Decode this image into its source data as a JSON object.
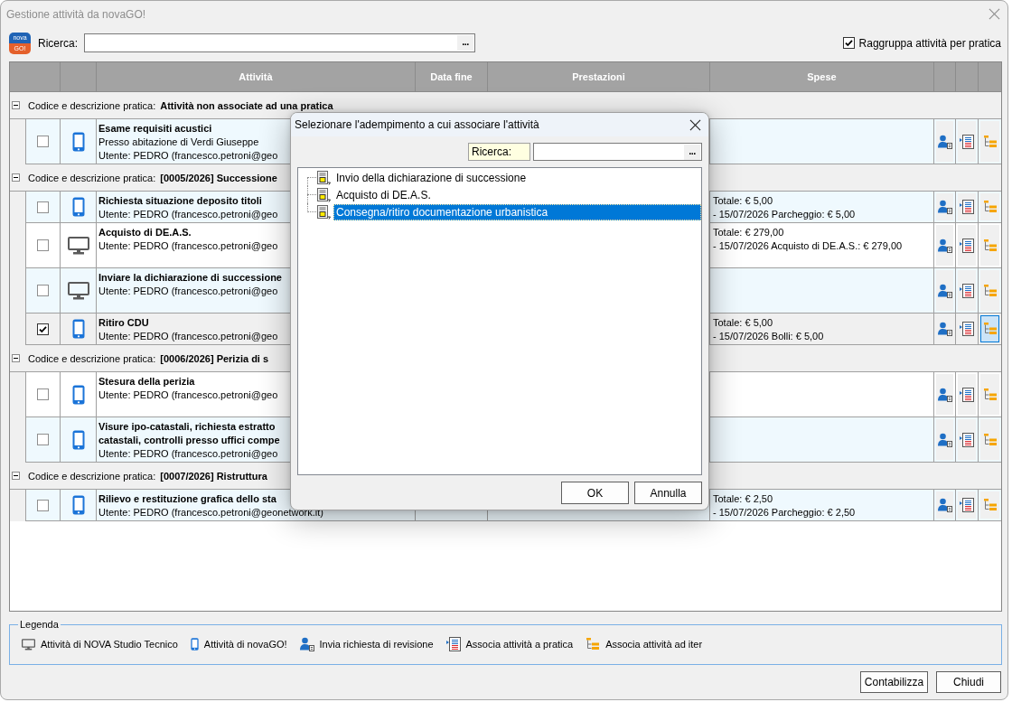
{
  "window": {
    "title": "Gestione attività da novaGO!"
  },
  "logo": {
    "top": "nova",
    "bottom": "GO!"
  },
  "search": {
    "label": "Ricerca:",
    "button": "..."
  },
  "group_by": {
    "label": "Raggruppa attività per pratica",
    "checked": true
  },
  "table": {
    "columns": [
      "Attività",
      "Data fine",
      "Prestazioni",
      "Spese"
    ],
    "groups": [
      {
        "label": "Codice e descrizione pratica:",
        "name": "Attività non associate ad una pratica",
        "expanded": true,
        "rows": [
          {
            "checked": false,
            "selected": false,
            "highlighted": true,
            "tall": false,
            "kind": "phone",
            "title": "Esame requisiti acustici",
            "details": [
              "Presso abitazione di Verdi Giuseppe",
              "Utente: PEDRO (francesco.petroni@geo"
            ],
            "actions": [
              {
                "kind": "revision",
                "selected": false
              },
              {
                "kind": "practice",
                "selected": false
              },
              {
                "kind": "iter",
                "selected": false
              }
            ]
          }
        ]
      },
      {
        "label": "Codice e descrizione pratica:",
        "name": "[0005/2026] Successione",
        "expanded": true,
        "rows": [
          {
            "checked": false,
            "selected": false,
            "highlighted": true,
            "tall": false,
            "kind": "phone",
            "title": "Richiesta situazione deposito titoli",
            "details": [
              "Utente: PEDRO (francesco.petroni@geo"
            ],
            "expenses": [
              "Totale: € 5,00",
              "- 15/07/2026 Parcheggio: € 5,00"
            ],
            "actions": [
              {
                "kind": "revision",
                "selected": false
              },
              {
                "kind": "practice",
                "selected": false
              },
              {
                "kind": "iter",
                "selected": false
              }
            ]
          },
          {
            "checked": false,
            "selected": false,
            "highlighted": false,
            "tall": true,
            "kind": "desktop",
            "title": "Acquisto di DE.A.S.",
            "details": [
              "Utente: PEDRO (francesco.petroni@geo"
            ],
            "expenses": [
              "Totale: € 279,00",
              "- 15/07/2026 Acquisto di DE.A.S.: € 279,00"
            ],
            "actions": [
              {
                "kind": "revision",
                "selected": false
              },
              {
                "kind": "practice",
                "selected": false
              },
              {
                "kind": "iter",
                "selected": false
              }
            ]
          },
          {
            "checked": false,
            "selected": false,
            "highlighted": true,
            "tall": true,
            "kind": "desktop",
            "title": "Inviare la dichiarazione di successione",
            "details": [
              "Utente: PEDRO (francesco.petroni@geo"
            ],
            "actions": [
              {
                "kind": "revision",
                "selected": false
              },
              {
                "kind": "practice",
                "selected": false
              },
              {
                "kind": "iter",
                "selected": false
              }
            ]
          },
          {
            "checked": true,
            "selected": true,
            "highlighted": false,
            "tall": false,
            "kind": "phone",
            "title": "Ritiro CDU",
            "details": [
              "Utente: PEDRO (francesco.petroni@geo"
            ],
            "expenses": [
              "Totale: € 5,00",
              "- 15/07/2026 Bolli: € 5,00"
            ],
            "actions": [
              {
                "kind": "revision",
                "selected": false
              },
              {
                "kind": "practice",
                "selected": false
              },
              {
                "kind": "iter",
                "selected": true
              }
            ]
          }
        ]
      },
      {
        "label": "Codice e descrizione pratica:",
        "name": "[0006/2026] Perizia di s",
        "expanded": true,
        "rows": [
          {
            "checked": false,
            "selected": false,
            "highlighted": false,
            "tall": true,
            "kind": "phone",
            "title": "Stesura della perizia",
            "details": [
              "Utente: PEDRO (francesco.petroni@geo"
            ],
            "actions": [
              {
                "kind": "revision",
                "selected": false
              },
              {
                "kind": "practice",
                "selected": false
              },
              {
                "kind": "iter",
                "selected": false
              }
            ]
          },
          {
            "checked": false,
            "selected": false,
            "highlighted": true,
            "tall": false,
            "kind": "phone",
            "title": "Visure ipo-catastali, richiesta estratto\ncatastali, controlli presso uffici compe",
            "details": [
              "Utente: PEDRO (francesco.petroni@geo"
            ],
            "actions": [
              {
                "kind": "revision",
                "selected": false
              },
              {
                "kind": "practice",
                "selected": false
              },
              {
                "kind": "iter",
                "selected": false
              }
            ]
          }
        ]
      },
      {
        "label": "Codice e descrizione pratica:",
        "name": "[0007/2026] Ristruttura",
        "expanded": true,
        "rows": [
          {
            "checked": false,
            "selected": false,
            "highlighted": true,
            "tall": false,
            "kind": "phone",
            "title": "Rilievo e restituzione grafica dello sta",
            "details": [
              "Utente: PEDRO (francesco.petroni@geonetwork.it)"
            ],
            "expenses": [
              "Totale: € 2,50",
              "- 15/07/2026 Parcheggio: € 2,50"
            ],
            "actions": [
              {
                "kind": "revision",
                "selected": false
              },
              {
                "kind": "practice",
                "selected": false
              },
              {
                "kind": "iter",
                "selected": false
              }
            ]
          }
        ]
      }
    ]
  },
  "legend": {
    "title": "Legenda",
    "items": [
      {
        "kind": "desktop",
        "label": "Attività di NOVA Studio Tecnico"
      },
      {
        "kind": "phone",
        "label": "Attività di novaGO!"
      },
      {
        "kind": "revision",
        "label": "Invia richiesta di revisione"
      },
      {
        "kind": "practice",
        "label": "Associa attività a pratica"
      },
      {
        "kind": "iter",
        "label": "Associa attività ad iter"
      }
    ]
  },
  "buttons": [
    "Contabilizza",
    "Chiudi"
  ],
  "dialog": {
    "title": "Selezionare l'adempimento a cui associare l'attività",
    "search": {
      "label": "Ricerca:",
      "button": "..."
    },
    "items": [
      {
        "label": "Invio della dichiarazione di successione",
        "selected": false
      },
      {
        "label": "Acquisto di DE.A.S.",
        "selected": false
      },
      {
        "label": "Consegna/ritiro documentazione urbanistica",
        "selected": true
      }
    ],
    "buttons": [
      "OK",
      "Annulla"
    ]
  }
}
